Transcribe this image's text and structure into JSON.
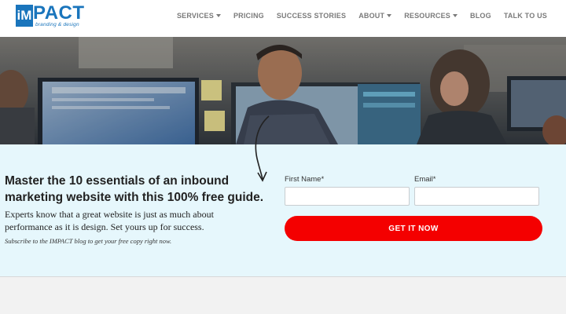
{
  "brand": {
    "logo_letter": "iM",
    "logo_rest": "PACT",
    "tagline": "branding & design",
    "color": "#1a75bc"
  },
  "nav": {
    "items": [
      {
        "label": "SERVICES",
        "dropdown": true
      },
      {
        "label": "PRICING",
        "dropdown": false
      },
      {
        "label": "SUCCESS STORIES",
        "dropdown": false
      },
      {
        "label": "ABOUT",
        "dropdown": true
      },
      {
        "label": "RESOURCES",
        "dropdown": true
      },
      {
        "label": "BLOG",
        "dropdown": false
      },
      {
        "label": "TALK TO US",
        "dropdown": false
      }
    ]
  },
  "offer": {
    "headline": "Master the 10 essentials of an inbound marketing website with this 100% free guide.",
    "body": "Experts know that a great website is just as much about performance as it is design. Set yours up for success.",
    "note": "Subscribe to the IMPACT blog to get your free copy right now."
  },
  "form": {
    "first_name_label": "First Name*",
    "email_label": "Email*",
    "first_name_value": "",
    "email_value": "",
    "submit_label": "GET IT NOW",
    "submit_color": "#f40000"
  },
  "colors": {
    "panel_bg": "#e6f7fc",
    "nav_text": "#7a7a7a"
  }
}
